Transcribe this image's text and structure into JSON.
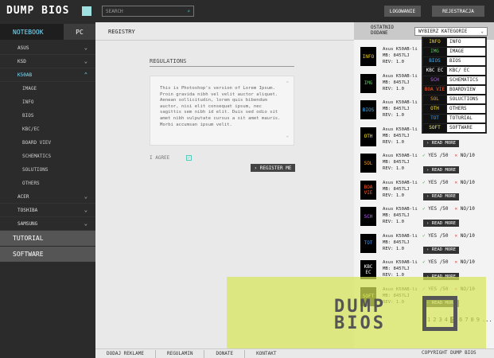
{
  "brand": {
    "logo_text": "DUMP BIOS",
    "box_color": "#9fe0e0"
  },
  "sidebar": {
    "tabs": [
      {
        "label": "NOTEBOOK"
      },
      {
        "label": "PC"
      }
    ],
    "brands": [
      {
        "label": "ASUS"
      },
      {
        "label": "KSD"
      },
      {
        "label": "K50AB"
      }
    ],
    "sub_items": [
      {
        "label": "IMAGE"
      },
      {
        "label": "INFO"
      },
      {
        "label": "BIOS"
      },
      {
        "label": "KBC/EC"
      },
      {
        "label": "BOARD VIEV"
      },
      {
        "label": "SCHEMATICS"
      },
      {
        "label": "SOLUTIONS"
      },
      {
        "label": "OTHERS"
      }
    ],
    "more_brands": [
      {
        "label": "ACER"
      },
      {
        "label": "TOSHIBA"
      },
      {
        "label": "SAMSUNG"
      }
    ],
    "big_items": [
      {
        "label": "TUTORIAL"
      },
      {
        "label": "SOFTWARE"
      }
    ]
  },
  "topbar": {
    "search_placeholder": "SEARCH",
    "search_icon": "search-icon",
    "login": "LOGOWANIE",
    "register": "REJESTRACJA"
  },
  "main": {
    "title": "REGISTRY",
    "section_label": "REGULATIONS",
    "terms_text": "This is Photoshop's version  of Lorem Ipsum. Proin gravida nibh vel velit auctor aliquet. Aenean sollicitudin, lorem quis bibendum auctor, nisi elit consequat ipsum, nec sagittis sem nibh id elit. Duis sed odio sit amet nibh vulputate cursus a sit amet mauris. Morbi accumsan ipsum velit.",
    "agree_label": "I AGREE",
    "register_button": "REGISTER ME"
  },
  "right": {
    "header_label_1": "OSTATNIO",
    "header_label_2": "DODANE",
    "select_value": "WYBIERZ KATEGORIE",
    "dropdown": [
      {
        "badge": "INFO",
        "label": "INFO",
        "color": "#f5d21a"
      },
      {
        "badge": "IMG",
        "label": "IMAGE",
        "color": "#4cd24c"
      },
      {
        "badge": "BIOS",
        "label": "BIOS",
        "color": "#39b6ff"
      },
      {
        "badge": "KBC EC",
        "label": "KBC/ EC",
        "color": "#ffffff"
      },
      {
        "badge": "SCH",
        "label": "SCHEMATICS",
        "color": "#c05cff"
      },
      {
        "badge": "BOA VIE",
        "label": "BOARDVIEW",
        "color": "#ff5a2a"
      },
      {
        "badge": "SOL",
        "label": "SOLUCTIONS",
        "color": "#ff9a1a"
      },
      {
        "badge": "OTH",
        "label": "OTHERS",
        "color": "#ffe41a"
      },
      {
        "badge": "TOT",
        "label": "TOTURIAL",
        "color": "#3aa0ff"
      },
      {
        "badge": "SOFT",
        "label": "SOFTWARE",
        "color": "#f0f070"
      }
    ],
    "items": [
      {
        "badge": "INFO",
        "color": "#f5d21a",
        "name": "Asus K50AB-li",
        "mb": "MB: 8457LJ",
        "rev": "REV: 1.0",
        "yes": "YES /50",
        "no": "NO/10",
        "more": "READ MORE"
      },
      {
        "badge": "IMG",
        "color": "#4cd24c",
        "name": "Asus K50AB-li",
        "mb": "MB: 8457LJ",
        "rev": "REV: 1.0",
        "yes": "YES /50",
        "no": "NO/10",
        "more": "READ MORE"
      },
      {
        "badge": "BIOS",
        "color": "#39b6ff",
        "name": "Asus K50AB-li",
        "mb": "MB: 8457LJ",
        "rev": "REV: 1.0",
        "yes": "YES /50",
        "no": "NO/10",
        "more": "READ MORE"
      },
      {
        "badge": "OTH",
        "color": "#ffe41a",
        "name": "Asus K50AB-li",
        "mb": "MB: 8457LJ",
        "rev": "REV: 1.0",
        "yes": "YES /50",
        "no": "NO/10",
        "more": "READ MORE"
      },
      {
        "badge": "SOL",
        "color": "#ff9a1a",
        "name": "Asus K50AB-li",
        "mb": "MB: 8457LJ",
        "rev": "REV: 1.0",
        "yes": "YES /50",
        "no": "NO/10",
        "more": "READ MORE"
      },
      {
        "badge": "BOA VIE",
        "color": "#ff5a2a",
        "name": "Asus K50AB-li",
        "mb": "MB: 8457LJ",
        "rev": "REV: 1.0",
        "yes": "YES /50",
        "no": "NO/10",
        "more": "READ MORE"
      },
      {
        "badge": "SCH",
        "color": "#c05cff",
        "name": "Asus K50AB-li",
        "mb": "MB: 8457LJ",
        "rev": "REV: 1.0",
        "yes": "YES /50",
        "no": "NO/10",
        "more": "READ MORE"
      },
      {
        "badge": "TOT",
        "color": "#3aa0ff",
        "name": "Asus K50AB-li",
        "mb": "MB: 8457LJ",
        "rev": "REV: 1.0",
        "yes": "YES /50",
        "no": "NO/10",
        "more": "READ MORE"
      },
      {
        "badge": "KBC EC",
        "color": "#ffffff",
        "name": "Asus K50AB-li",
        "mb": "MB: 8457LJ",
        "rev": "REV: 1.0",
        "yes": "YES /50",
        "no": "NO/10",
        "more": "READ MORE"
      },
      {
        "badge": "SOFT",
        "color": "#f0f070",
        "name": "Asus K50AB-li",
        "mb": "MB: 8457LJ",
        "rev": "REV: 1.0",
        "yes": "YES /50",
        "no": "NO/10",
        "more": "READ MORE"
      }
    ],
    "pager": [
      "1",
      "2",
      "3",
      "4",
      "5",
      "6",
      "7",
      "8",
      "9",
      "..."
    ],
    "pager_current": "5"
  },
  "footer": {
    "links": [
      "DODAJ REKLAME",
      "REGULAMIN",
      "DONATE",
      "KONTAKT"
    ],
    "copyright": "COPYRIGHT DUMP BIOS"
  },
  "overlay": {
    "logo_line1": "DUMP",
    "logo_line2": "BIOS",
    "color": "#d7e65a"
  }
}
